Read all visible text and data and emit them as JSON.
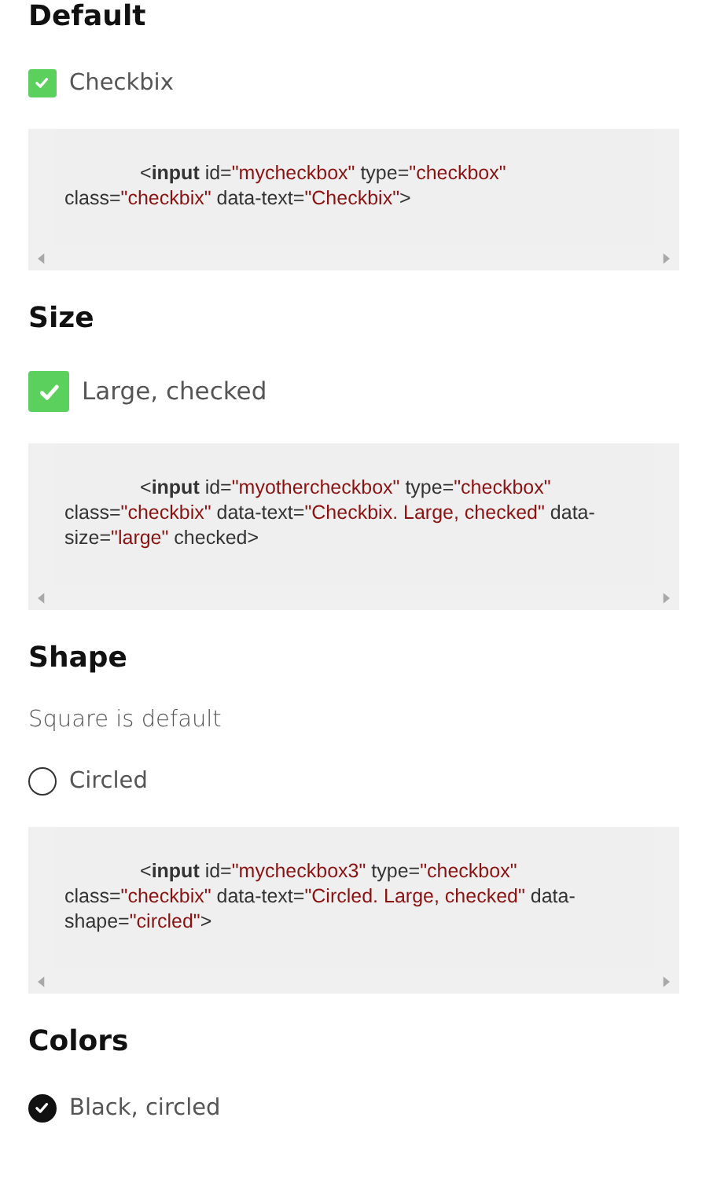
{
  "sections": [
    {
      "heading": "Default",
      "blocks": [
        {
          "kind": "checkbox",
          "label": "Checkbix",
          "checked": true,
          "color": "#5cd05c"
        },
        {
          "kind": "code",
          "tokens": [
            {
              "kind": "punct",
              "text": "<"
            },
            {
              "kind": "tag",
              "text": "input"
            },
            {
              "kind": "attr",
              "text": " id="
            },
            {
              "kind": "value",
              "text": "\"mycheckbox\""
            },
            {
              "kind": "attr",
              "text": " type="
            },
            {
              "kind": "value",
              "text": "\"checkbox\""
            },
            {
              "kind": "attr",
              "text": " class="
            },
            {
              "kind": "value",
              "text": "\"checkbix\""
            },
            {
              "kind": "attr",
              "text": " data-text="
            },
            {
              "kind": "value",
              "text": "\"Checkbix\""
            },
            {
              "kind": "punct",
              "text": ">"
            }
          ]
        }
      ]
    },
    {
      "heading": "Size",
      "blocks": [
        {
          "kind": "largecheckbox",
          "label": "Large, checked",
          "checked": true,
          "color": "#5cd05c"
        },
        {
          "kind": "code",
          "tokens": [
            {
              "kind": "punct",
              "text": "<"
            },
            {
              "kind": "tag",
              "text": "input"
            },
            {
              "kind": "attr",
              "text": " id="
            },
            {
              "kind": "value",
              "text": "\"myothercheckbox\""
            },
            {
              "kind": "attr",
              "text": " type="
            },
            {
              "kind": "value",
              "text": "\"checkbox\""
            },
            {
              "kind": "attr",
              "text": " class="
            },
            {
              "kind": "value",
              "text": "\"checkbix\""
            },
            {
              "kind": "attr",
              "text": " data-text="
            },
            {
              "kind": "value",
              "text": "\"Checkbix. Large, checked\""
            },
            {
              "kind": "attr",
              "text": " data-size="
            },
            {
              "kind": "value",
              "text": "\"large\""
            },
            {
              "kind": "attr",
              "text": " checked"
            },
            {
              "kind": "punct",
              "text": ">"
            }
          ]
        }
      ]
    },
    {
      "heading": "Shape",
      "blocks": [
        {
          "kind": "note",
          "text": "Square is default"
        },
        {
          "kind": "roundcheckbox",
          "label": "Circled",
          "checked": false
        },
        {
          "kind": "code",
          "tokens": [
            {
              "kind": "punct",
              "text": "<"
            },
            {
              "kind": "tag",
              "text": "input"
            },
            {
              "kind": "attr",
              "text": " id="
            },
            {
              "kind": "value",
              "text": "\"mycheckbox3\""
            },
            {
              "kind": "attr",
              "text": " type="
            },
            {
              "kind": "value",
              "text": "\"checkbox\""
            },
            {
              "kind": "attr",
              "text": " class="
            },
            {
              "kind": "value",
              "text": "\"checkbix\""
            },
            {
              "kind": "attr",
              "text": " data-text="
            },
            {
              "kind": "value",
              "text": "\"Circled. Large, checked\""
            },
            {
              "kind": "attr",
              "text": " data-shape="
            },
            {
              "kind": "value",
              "text": "\"circled\""
            },
            {
              "kind": "punct",
              "text": ">"
            }
          ]
        }
      ]
    },
    {
      "heading": "Colors",
      "blocks": [
        {
          "kind": "roundcheckbox",
          "label": "Black, circled",
          "checked": true,
          "color": "#111111"
        }
      ]
    }
  ]
}
